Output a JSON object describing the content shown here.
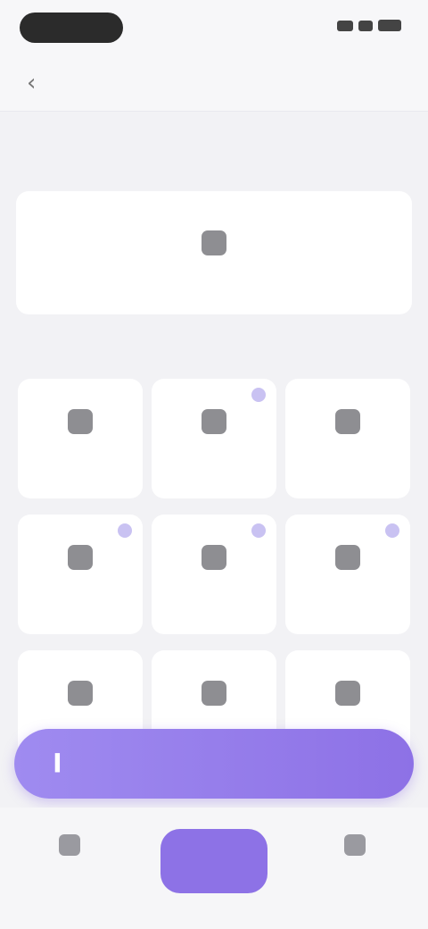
{
  "status_bar": {
    "time": ""
  },
  "header": {
    "title": ""
  },
  "sections": {
    "top_label": "",
    "grid_label": ""
  },
  "top_card": {
    "label": ""
  },
  "tiles": [
    {
      "label": ""
    },
    {
      "label": ""
    },
    {
      "label": ""
    },
    {
      "label": ""
    },
    {
      "label": ""
    },
    {
      "label": ""
    },
    {
      "label": ""
    },
    {
      "label": ""
    },
    {
      "label": ""
    }
  ],
  "cta": {
    "label": ""
  },
  "bottom_nav": {
    "left_label": "",
    "center_label": "",
    "right_label": ""
  },
  "colors": {
    "accent": "#8d72e6",
    "accent_light": "#c9c2f2",
    "background": "#f2f2f5"
  }
}
